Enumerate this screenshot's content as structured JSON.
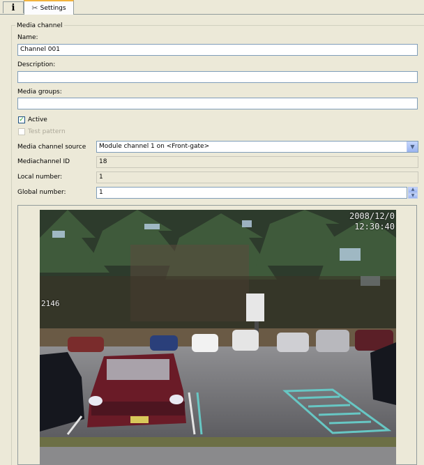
{
  "tabs": [
    {
      "label": "",
      "icon": "info-icon"
    },
    {
      "label": "Settings",
      "icon": "wrench-icon"
    }
  ],
  "group": {
    "title": "Media channel"
  },
  "form": {
    "name_label": "Name:",
    "name_value": "Channel 001",
    "description_label": "Description:",
    "description_value": "",
    "media_groups_label": "Media groups:",
    "media_groups_value": "",
    "active_label": "Active",
    "active_checked": true,
    "test_pattern_label": "Test pattern",
    "test_pattern_checked": false,
    "source_label": "Media channel source",
    "source_value": "Module channel 1 on <Front-gate>",
    "id_label": "Mediachannel ID",
    "id_value": "18",
    "local_label": "Local number:",
    "local_value": "1",
    "global_label": "Global number:",
    "global_value": "1"
  },
  "preview": {
    "osd_date": "2008/12/0",
    "osd_time": "12:30:40",
    "osd_side": "2146"
  }
}
